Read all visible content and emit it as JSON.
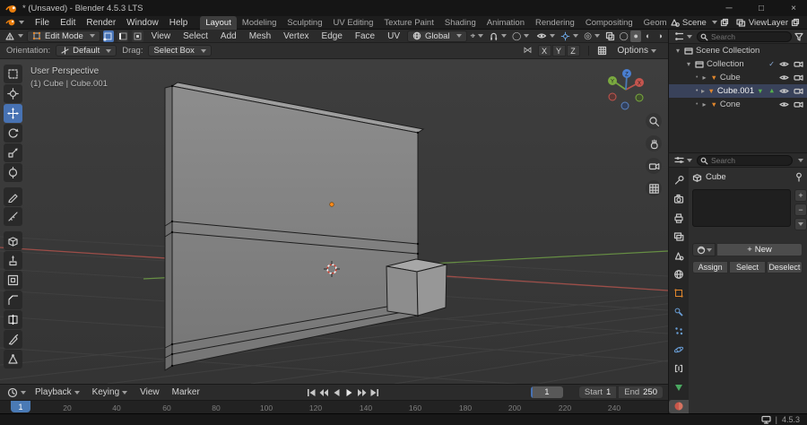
{
  "titlebar": {
    "title": "* (Unsaved) - Blender 4.5.3 LTS"
  },
  "icons": {
    "minimize": "─",
    "maximize": "□",
    "close": "×",
    "collapse": "▾",
    "expand": "▸",
    "mesh": "▼",
    "dot": "•",
    "check": "✓",
    "proportional": "◯",
    "pivot": "⌖",
    "mirror": "⋈",
    "plus": "+",
    "minus": "−",
    "overlays": "◎",
    "shading": [
      "◯",
      "●",
      "◐",
      "◑"
    ]
  },
  "menubar": {
    "menus": [
      "File",
      "Edit",
      "Render",
      "Window",
      "Help"
    ],
    "workspaces": [
      "Layout",
      "Modeling",
      "Sculpting",
      "UV Editing",
      "Texture Paint",
      "Shading",
      "Animation",
      "Rendering",
      "Compositing",
      "Geometry Node"
    ],
    "scene_label": "Scene",
    "view_layer_label": "ViewLayer"
  },
  "tool_header": {
    "mode": "Edit Mode",
    "menus": [
      "View",
      "Select",
      "Add",
      "Mesh",
      "Vertex",
      "Edge",
      "Face",
      "UV"
    ],
    "orientation": "Global"
  },
  "tool_settings": {
    "orientation_label": "Orientation:",
    "orientation_value": "Default",
    "drag_label": "Drag:",
    "drag_value": "Select Box",
    "axes": [
      "X",
      "Y",
      "Z"
    ],
    "options_label": "Options"
  },
  "viewport": {
    "view_label": "User Perspective",
    "selection_label": "(1) Cube | Cube.001",
    "axis_x": "X",
    "axis_y": "Y",
    "axis_z": "Z"
  },
  "outliner": {
    "search_placeholder": "Search",
    "rows": [
      "Scene Collection",
      "Collection",
      "Cube",
      "Cube.001",
      "Cone"
    ]
  },
  "properties": {
    "search_placeholder": "Search",
    "breadcrumb": "Cube",
    "new_label": "New",
    "assign_label": "Assign",
    "select_label": "Select",
    "deselect_label": "Deselect"
  },
  "timeline": {
    "menus": [
      "Playback",
      "Keying",
      "View",
      "Marker"
    ],
    "current_frame": "1",
    "start_label": "Start",
    "start_value": "1",
    "end_label": "End",
    "end_value": "250",
    "playhead": "1",
    "ticks": [
      "20",
      "40",
      "60",
      "80",
      "100",
      "120",
      "140",
      "160",
      "180",
      "200",
      "220",
      "240"
    ]
  },
  "statusbar": {
    "version": "4.5.3"
  },
  "colors": {
    "accent": "#4772b3",
    "object_orange": "#e0862c",
    "data_green": "#55b24e",
    "axis_x_red": "#c8504b",
    "axis_y_green": "#6fae3c",
    "axis_z_blue": "#4a7fd0"
  }
}
